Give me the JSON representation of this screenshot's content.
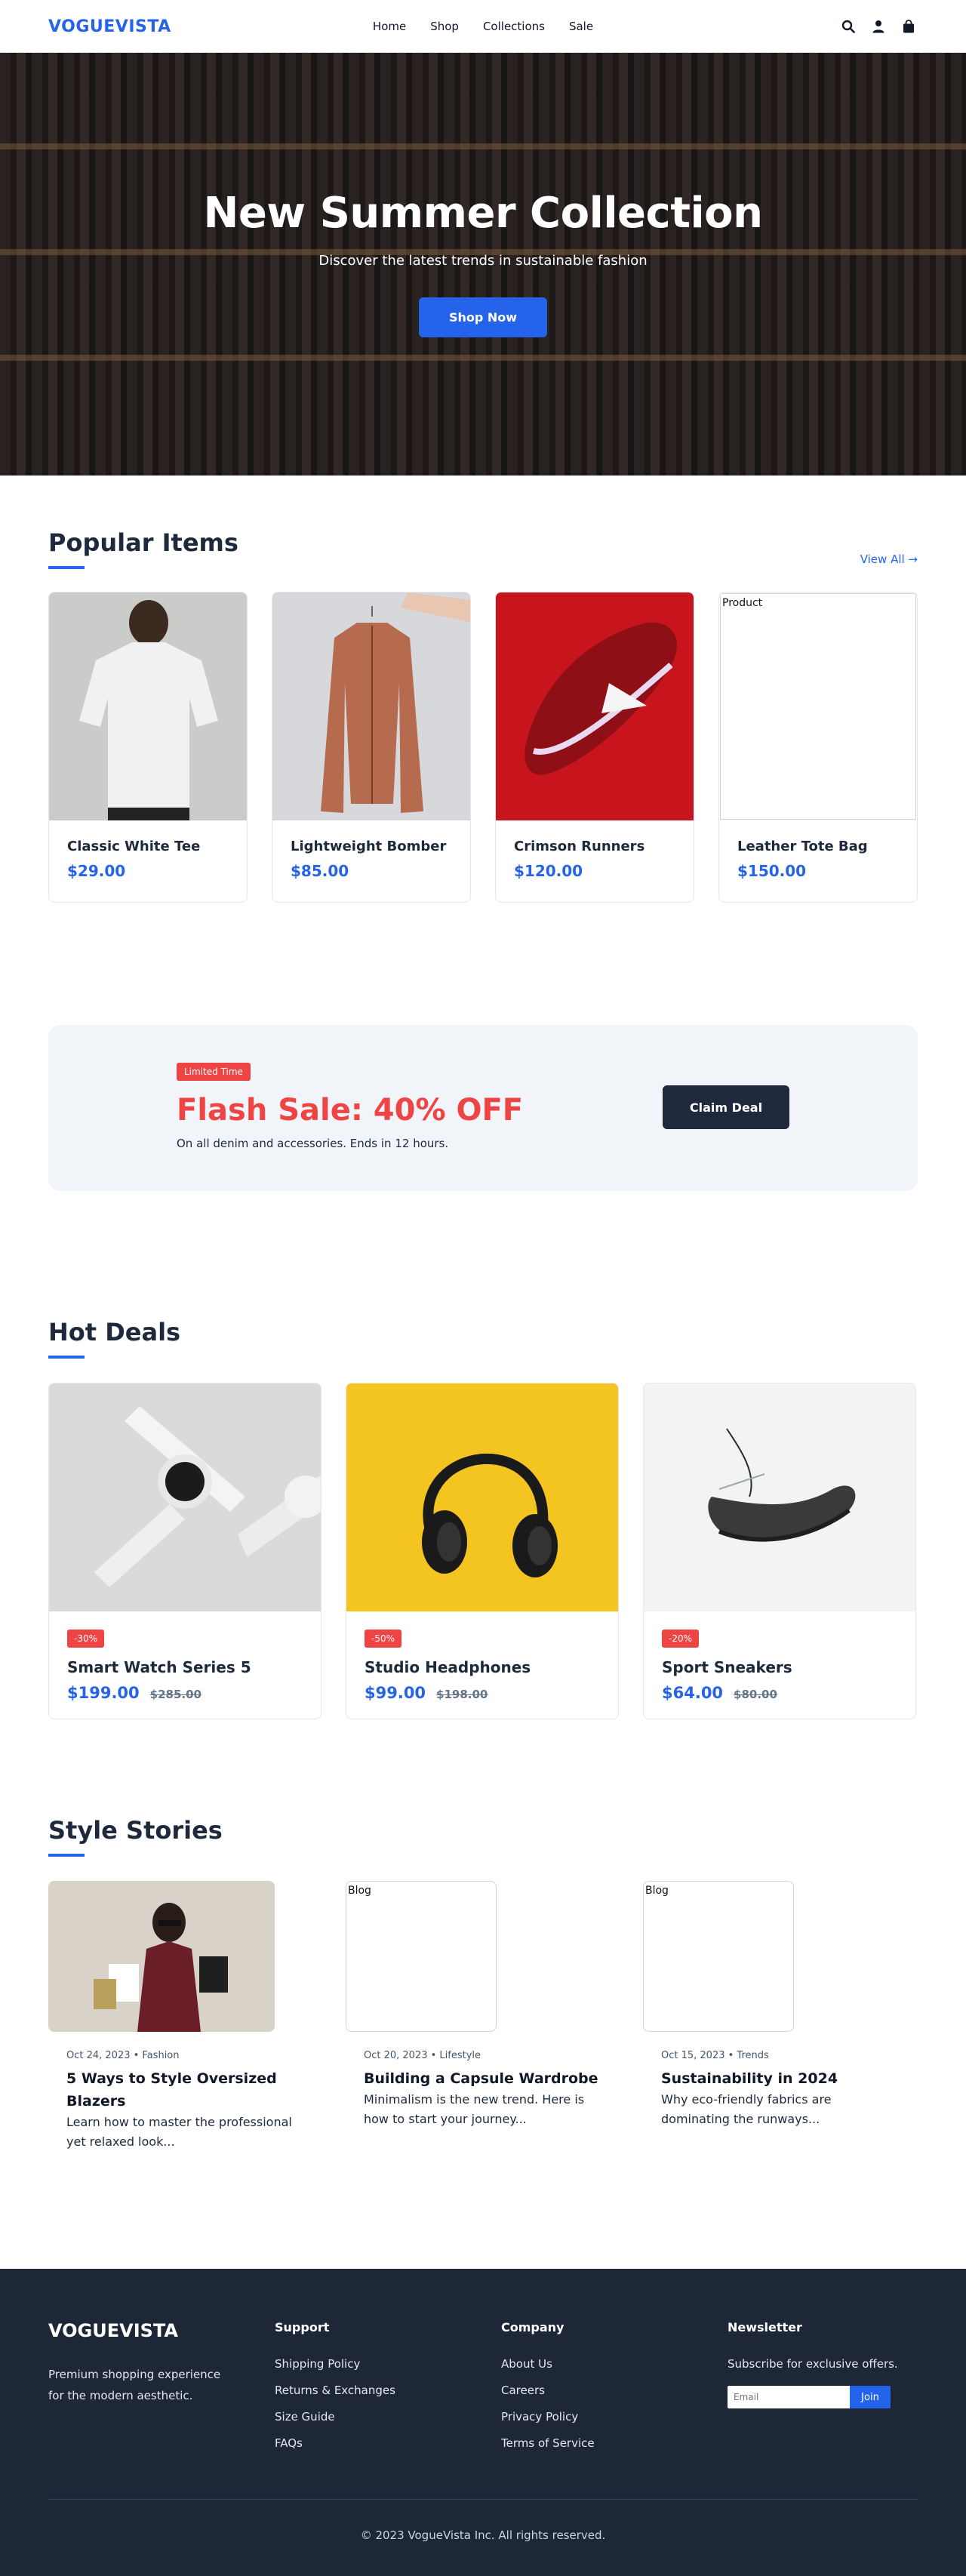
{
  "header": {
    "logo": "VOGUEVISTA",
    "nav": [
      "Home",
      "Shop",
      "Collections",
      "Sale"
    ],
    "icons": [
      "search-icon",
      "user-icon",
      "bag-icon"
    ]
  },
  "hero": {
    "title": "New Summer Collection",
    "subtitle": "Discover the latest trends in sustainable fashion",
    "cta": "Shop Now"
  },
  "popular": {
    "title": "Popular Items",
    "view_all": "View All →",
    "items": [
      {
        "name": "Classic White Tee",
        "price": "$29.00"
      },
      {
        "name": "Lightweight Bomber",
        "price": "$85.00"
      },
      {
        "name": "Crimson Runners",
        "price": "$120.00"
      },
      {
        "name": "Leather Tote Bag",
        "price": "$150.00",
        "broken_alt": "Product"
      }
    ]
  },
  "flash": {
    "badge": "Limited Time",
    "title": "Flash Sale: 40% OFF",
    "text": "On all denim and accessories. Ends in 12 hours.",
    "cta": "Claim Deal"
  },
  "deals": {
    "title": "Hot Deals",
    "items": [
      {
        "badge": "-30%",
        "name": "Smart Watch Series 5",
        "price": "$199.00",
        "old_price": "$285.00"
      },
      {
        "badge": "-50%",
        "name": "Studio Headphones",
        "price": "$99.00",
        "old_price": "$198.00"
      },
      {
        "badge": "-20%",
        "name": "Sport Sneakers",
        "price": "$64.00",
        "old_price": "$80.00"
      }
    ]
  },
  "stories": {
    "title": "Style Stories",
    "items": [
      {
        "meta": "Oct 24, 2023 • Fashion",
        "title": "5 Ways to Style Oversized Blazers",
        "excerpt": "Learn how to master the professional yet relaxed look..."
      },
      {
        "meta": "Oct 20, 2023 • Lifestyle",
        "title": "Building a Capsule Wardrobe",
        "excerpt": "Minimalism is the new trend. Here is how to start your journey...",
        "broken_alt": "Blog"
      },
      {
        "meta": "Oct 15, 2023 • Trends",
        "title": "Sustainability in 2024",
        "excerpt": "Why eco-friendly fabrics are dominating the runways...",
        "broken_alt": "Blog"
      }
    ]
  },
  "footer": {
    "logo": "VOGUEVISTA",
    "description": "Premium shopping experience for the modern aesthetic.",
    "support_title": "Support",
    "support_links": [
      "Shipping Policy",
      "Returns & Exchanges",
      "Size Guide",
      "FAQs"
    ],
    "company_title": "Company",
    "company_links": [
      "About Us",
      "Careers",
      "Privacy Policy",
      "Terms of Service"
    ],
    "newsletter_title": "Newsletter",
    "newsletter_text": "Subscribe for exclusive offers.",
    "email_placeholder": "Email",
    "join": "Join",
    "copyright": "© 2023 VogueVista Inc. All rights reserved."
  }
}
